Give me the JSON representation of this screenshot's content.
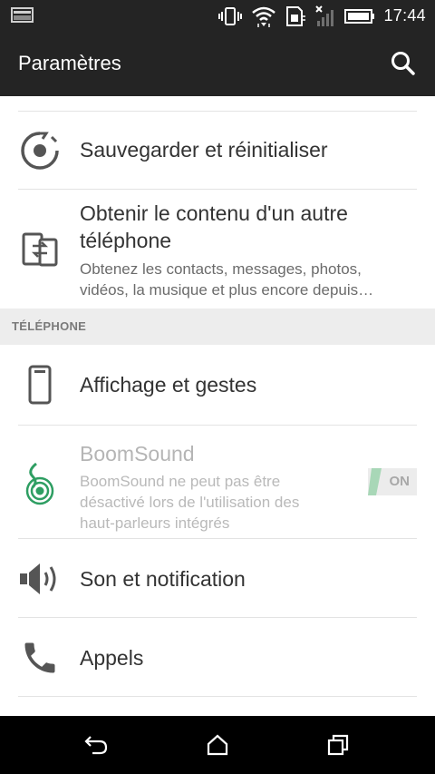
{
  "status_bar": {
    "time": "17:44",
    "icons": [
      "screenshot-notification-icon",
      "vibrate-icon",
      "wifi-icon",
      "sim-icon",
      "no-signal-icon",
      "battery-icon"
    ]
  },
  "app_bar": {
    "title": "Paramètres",
    "search_icon": "search-icon"
  },
  "settings": {
    "items": [
      {
        "title": "Sauvegarder et réinitialiser",
        "icon": "backup-restore-icon"
      },
      {
        "title_line1": "Obtenir le contenu d'un autre",
        "title_line2": "téléphone",
        "subtitle_line1": "Obtenez les contacts, messages, photos,",
        "subtitle_line2": "vidéos, la musique et plus encore depuis…",
        "icon": "phone-transfer-icon"
      }
    ]
  },
  "phone_section": {
    "header": "TÉLÉPHONE",
    "items": [
      {
        "title": "Affichage et gestes",
        "icon": "phone-display-icon"
      },
      {
        "title": "BoomSound",
        "subtitle_line1": "BoomSound ne peut pas être",
        "subtitle_line2": "désactivé lors de l'utilisation des",
        "subtitle_line3": "haut-parleurs intégrés",
        "toggle_label": "ON",
        "toggle_state": "on",
        "enabled": false,
        "icon": "boomsound-icon",
        "accent": "#2e9e62"
      },
      {
        "title": "Son et notification",
        "icon": "speaker-icon"
      },
      {
        "title": "Appels",
        "icon": "phone-call-icon"
      }
    ]
  },
  "nav_bar": {
    "back_icon": "back-icon",
    "home_icon": "home-icon",
    "recents_icon": "recents-icon"
  },
  "colors": {
    "bar_background": "#242424",
    "nav_background": "#000000",
    "section_background": "#ededed",
    "toggle_green": "#a8d7b7"
  }
}
